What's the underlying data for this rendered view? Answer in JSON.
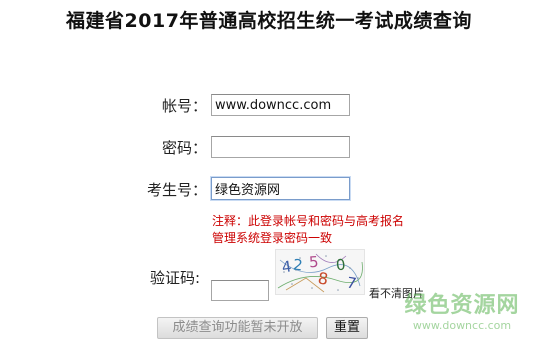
{
  "page": {
    "title": "福建省2017年普通高校招生统一考试成绩查询"
  },
  "form": {
    "account": {
      "label": "帐号：",
      "value": "www.downcc.com"
    },
    "password": {
      "label": "密码：",
      "value": ""
    },
    "exam_number": {
      "label": "考生号：",
      "value": "绿色资源网"
    },
    "note": {
      "line1": "注释：此登录帐号和密码与高考报名",
      "line2": "管理系统登录密码一致"
    },
    "captcha": {
      "label": "验证码:",
      "value": "",
      "image_text": [
        "4",
        "2",
        "5",
        "8",
        "0",
        "7"
      ],
      "refresh_label": "看不清图片"
    },
    "buttons": {
      "query_label": "成绩查询功能暂未开放",
      "reset_label": "重置"
    }
  },
  "watermark": {
    "logo": "绿色资源网",
    "url": "www.downcc.com",
    "color": "#5ab250"
  }
}
